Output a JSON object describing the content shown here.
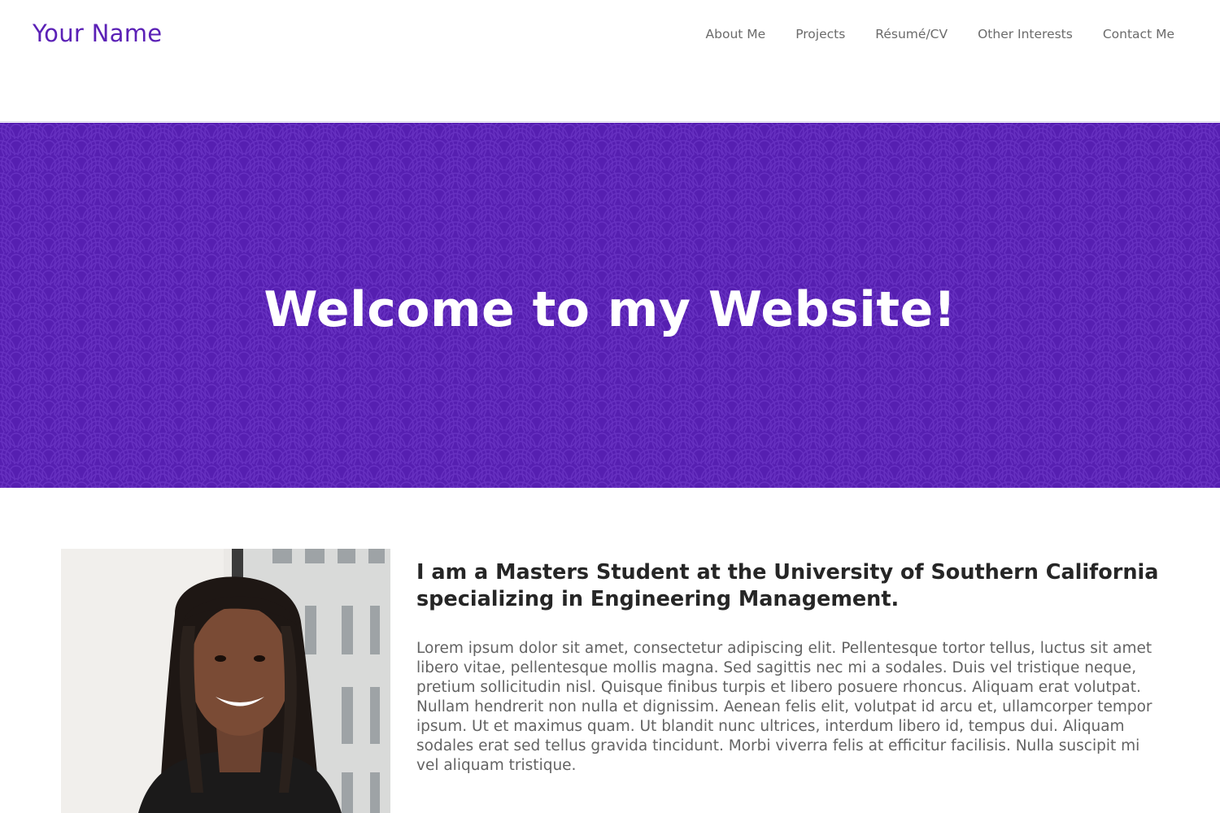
{
  "header": {
    "brand": "Your Name",
    "nav": [
      {
        "label": "About Me"
      },
      {
        "label": "Projects"
      },
      {
        "label": "Résumé/CV"
      },
      {
        "label": "Other Interests"
      },
      {
        "label": "Contact Me"
      }
    ]
  },
  "hero": {
    "title": "Welcome to my Website!"
  },
  "about": {
    "photo_alt": "portrait photo",
    "heading": "I am a Masters Student at the University of Southern California specializing in Engineering Management.",
    "body": "Lorem ipsum dolor sit amet, consectetur adipiscing elit. Pellentesque tortor tellus, luctus sit amet libero vitae, pellentesque mollis magna. Sed sagittis nec mi a sodales. Duis vel tristique neque, pretium sollicitudin nisl. Quisque finibus turpis et libero posuere rhoncus. Aliquam erat volutpat. Nullam hendrerit non nulla et dignissim. Aenean felis elit, volutpat id arcu et, ullamcorper tempor ipsum. Ut et maximus quam. Ut blandit nunc ultrices, interdum libero id, tempus dui. Aliquam sodales erat sed tellus gravida tincidunt. Morbi viverra felis at efficitur facilisis. Nulla suscipit mi vel aliquam tristique."
  },
  "colors": {
    "brand": "#5b21b6",
    "hero_background": "#561fb1",
    "nav_text": "#6b6b6b",
    "heading_text": "#262626",
    "body_text": "#636363"
  }
}
